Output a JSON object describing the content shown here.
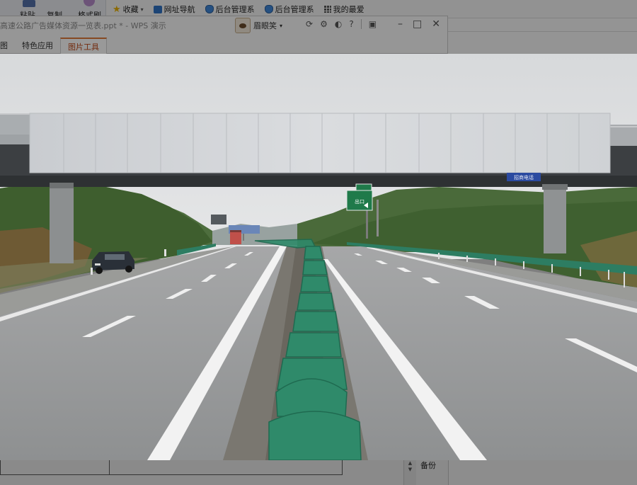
{
  "ribbon": {
    "paste_label": "粘贴",
    "copy_label": "复制",
    "format_painter_label": "格式刷"
  },
  "bookmarks": [
    {
      "label": "收藏",
      "icon": "star-icon"
    },
    {
      "label": "网址导航",
      "icon": "nav-icon"
    },
    {
      "label": "后台管理系",
      "icon": "shield-icon"
    },
    {
      "label": "后台管理系",
      "icon": "shield-icon"
    },
    {
      "label": "我的最爱",
      "icon": "grid-icon"
    }
  ],
  "wps": {
    "title": "高速公路广告媒体资源一览表.ppt * - WPS 演示",
    "user": "眉眼笑",
    "tabs": [
      "图",
      "特色应用",
      "图片工具"
    ],
    "active_tab": "图片工具"
  },
  "photo": {
    "sign_text": "出口",
    "plate_text": "招商电话"
  },
  "bottom": {
    "backup_label": "备份",
    "scroll_top": "▲",
    "scroll_bottom": "▼"
  },
  "colors": {
    "accent_tab": "#e07b39",
    "guardrail": "#2f8a6a",
    "sky": "#dfe2e5",
    "road": "#8f9193"
  }
}
